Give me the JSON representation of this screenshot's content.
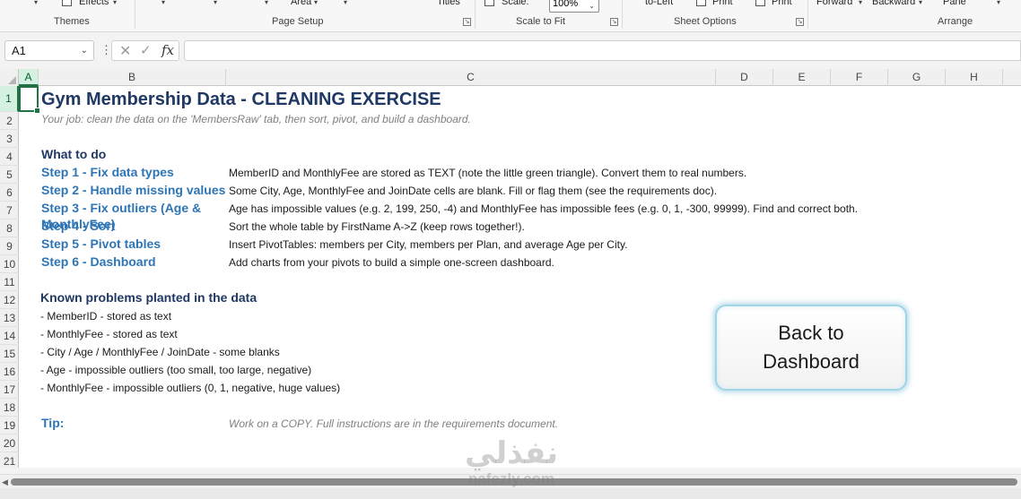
{
  "ribbon": {
    "effects_label": "Effects",
    "themes_label": "Themes",
    "area_label": "Area",
    "page_setup_label": "Page Setup",
    "titles_label": "Titles",
    "scale_label": "Scale:",
    "scale_value": "100%",
    "scale_to_fit_label": "Scale to Fit",
    "left_to_right_label": "to-Left",
    "print1_label": "Print",
    "print2_label": "Print",
    "sheet_options_label": "Sheet Options",
    "forward_label": "Forward",
    "backward_label": "Backward",
    "pane_label": "Pane",
    "arrange_label": "Arrange"
  },
  "formula_bar": {
    "name_box": "A1",
    "fx": "fx",
    "content": ""
  },
  "columns": [
    "A",
    "B",
    "C",
    "D",
    "E",
    "F",
    "G",
    "H"
  ],
  "rows": [
    "1",
    "2",
    "3",
    "4",
    "5",
    "6",
    "7",
    "8",
    "9",
    "10",
    "11",
    "12",
    "13",
    "14",
    "15",
    "16",
    "17",
    "18",
    "19",
    "20",
    "21"
  ],
  "sheet": {
    "title": "Gym Membership Data - CLEANING EXERCISE",
    "subtitle": "Your job: clean the data on the 'MembersRaw' tab, then sort, pivot, and build a dashboard.",
    "what_to_do": "What to do",
    "steps": [
      {
        "label": "Step 1 - Fix data types",
        "desc": "MemberID and MonthlyFee are stored as TEXT (note the little green triangle). Convert them to real numbers."
      },
      {
        "label": "Step 2 - Handle missing values",
        "desc": "Some City, Age, MonthlyFee and JoinDate cells are blank. Fill or flag them (see the requirements doc)."
      },
      {
        "label": "Step 3 - Fix outliers (Age & MonthlyFee)",
        "desc": "Age has impossible values (e.g. 2, 199, 250, -4) and MonthlyFee has impossible fees (e.g. 0, 1, -300, 99999). Find and correct both."
      },
      {
        "label": "Step 4 - Sort",
        "desc": "Sort the whole table by FirstName A->Z (keep rows together!)."
      },
      {
        "label": "Step 5 - Pivot tables",
        "desc": "Insert PivotTables: members per City, members per Plan, and average Age per City."
      },
      {
        "label": "Step 6 - Dashboard",
        "desc": "Add charts from your pivots to build a simple one-screen dashboard."
      }
    ],
    "known_problems": "Known problems planted in the data",
    "problems": [
      "- MemberID - stored as text",
      "- MonthlyFee - stored as text",
      "- City / Age / MonthlyFee / JoinDate - some blanks",
      "- Age - impossible outliers (too small, too large, negative)",
      "- MonthlyFee - impossible outliers (0, 1, negative, huge values)"
    ],
    "tip_label": "Tip:",
    "tip_text": "Work on a COPY. Full instructions are in the requirements document.",
    "back_button": "Back to\nDashboard"
  },
  "watermark": {
    "arabic": "نفذلي",
    "latin": "nafezly.com"
  },
  "colors": {
    "title": "#1f3864",
    "step": "#2e75b6",
    "muted": "#7f7f7f",
    "accent": "#217346"
  }
}
